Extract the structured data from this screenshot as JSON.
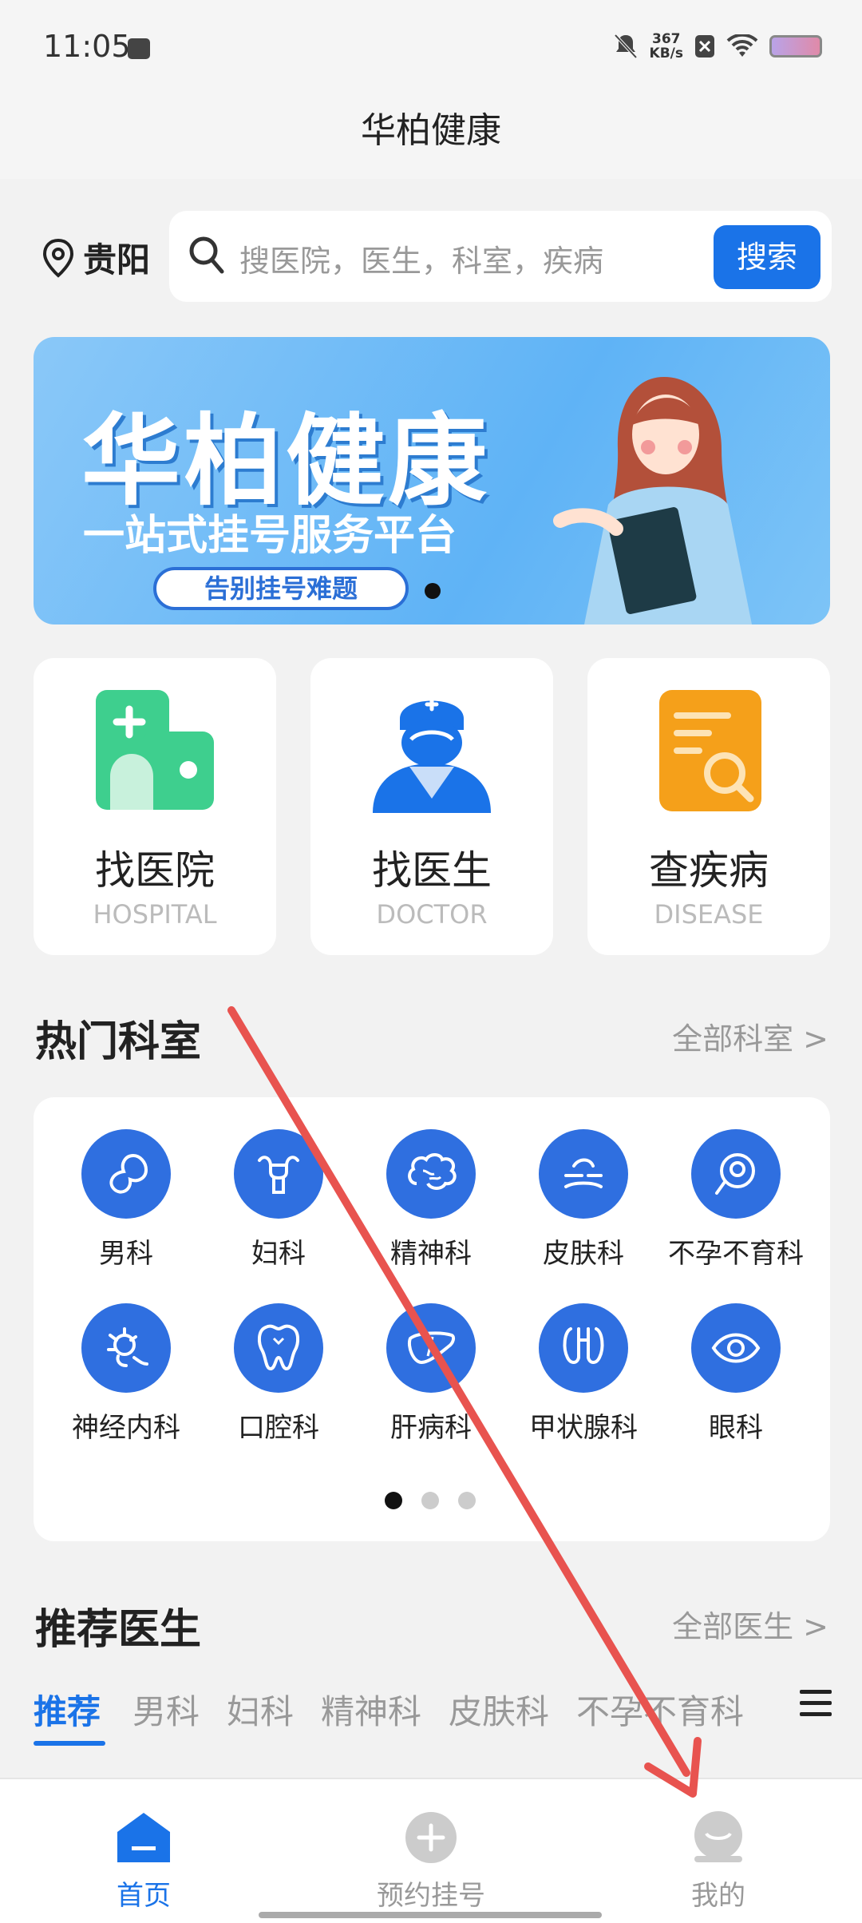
{
  "status_bar": {
    "time": "11:05",
    "net_speed_value": "367",
    "net_speed_unit": "KB/s"
  },
  "header": {
    "title": "华柏健康"
  },
  "location": {
    "city": "贵阳"
  },
  "search": {
    "placeholder": "搜医院，医生，科室，疾病",
    "button_label": "搜索"
  },
  "banner": {
    "title": "华柏健康",
    "subtitle": "一站式挂号服务平台",
    "tagline": "告别挂号难题"
  },
  "quick_entries": [
    {
      "cn": "找医院",
      "en": "HOSPITAL",
      "color": "#3ecf8e"
    },
    {
      "cn": "找医生",
      "en": "DOCTOR",
      "color": "#1a73e8"
    },
    {
      "cn": "查疾病",
      "en": "DISEASE",
      "color": "#f5a01a"
    }
  ],
  "hot_departments": {
    "title": "热门科室",
    "link": "全部科室 >",
    "items": [
      {
        "label": "男科",
        "icon": "male-icon"
      },
      {
        "label": "妇科",
        "icon": "uterus-icon"
      },
      {
        "label": "精神科",
        "icon": "brain-icon"
      },
      {
        "label": "皮肤科",
        "icon": "skin-icon"
      },
      {
        "label": "不孕不育科",
        "icon": "embryo-icon"
      },
      {
        "label": "神经内科",
        "icon": "neuron-icon"
      },
      {
        "label": "口腔科",
        "icon": "tooth-icon"
      },
      {
        "label": "肝病科",
        "icon": "liver-icon"
      },
      {
        "label": "甲状腺科",
        "icon": "thyroid-icon"
      },
      {
        "label": "眼科",
        "icon": "eye-icon"
      }
    ]
  },
  "recommended_doctors": {
    "title": "推荐医生",
    "link": "全部医生 >",
    "tabs": [
      "推荐",
      "男科",
      "妇科",
      "精神科",
      "皮肤科",
      "不孕不育科"
    ]
  },
  "bottom_nav": [
    {
      "label": "首页",
      "icon": "home-icon",
      "active": true
    },
    {
      "label": "预约挂号",
      "icon": "add-icon",
      "active": false
    },
    {
      "label": "我的",
      "icon": "profile-icon",
      "active": false
    }
  ],
  "colors": {
    "accent": "#1a73e8",
    "annotation_arrow": "#e8534f"
  }
}
